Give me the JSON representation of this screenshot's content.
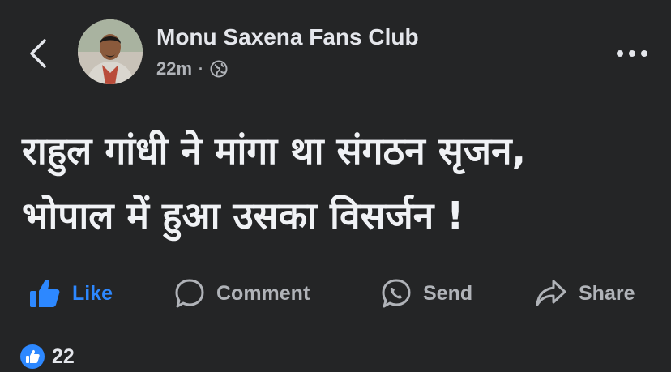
{
  "header": {
    "page_name": "Monu Saxena Fans Club",
    "time_ago": "22m",
    "separator": "·",
    "audience_icon": "globe-icon",
    "back_icon": "chevron-left-icon",
    "more_icon": "more-horizontal-icon"
  },
  "post": {
    "line1": "राहुल गांधी ने मांगा था संगठन सृजन,",
    "line2": "भोपाल में हुआ उसका विसर्जन !"
  },
  "actions": {
    "like": {
      "label": "Like",
      "icon": "thumbs-up-icon",
      "color": "#2d88ff"
    },
    "comment": {
      "label": "Comment",
      "icon": "comment-bubble-icon"
    },
    "send": {
      "label": "Send",
      "icon": "messenger-icon"
    },
    "share": {
      "label": "Share",
      "icon": "share-arrow-icon"
    }
  },
  "reactions": {
    "icon": "like-reaction-icon",
    "count": "22"
  },
  "colors": {
    "background": "#242526",
    "text_primary": "#e4e6eb",
    "text_secondary": "#b0b3b8",
    "accent": "#2d88ff"
  }
}
